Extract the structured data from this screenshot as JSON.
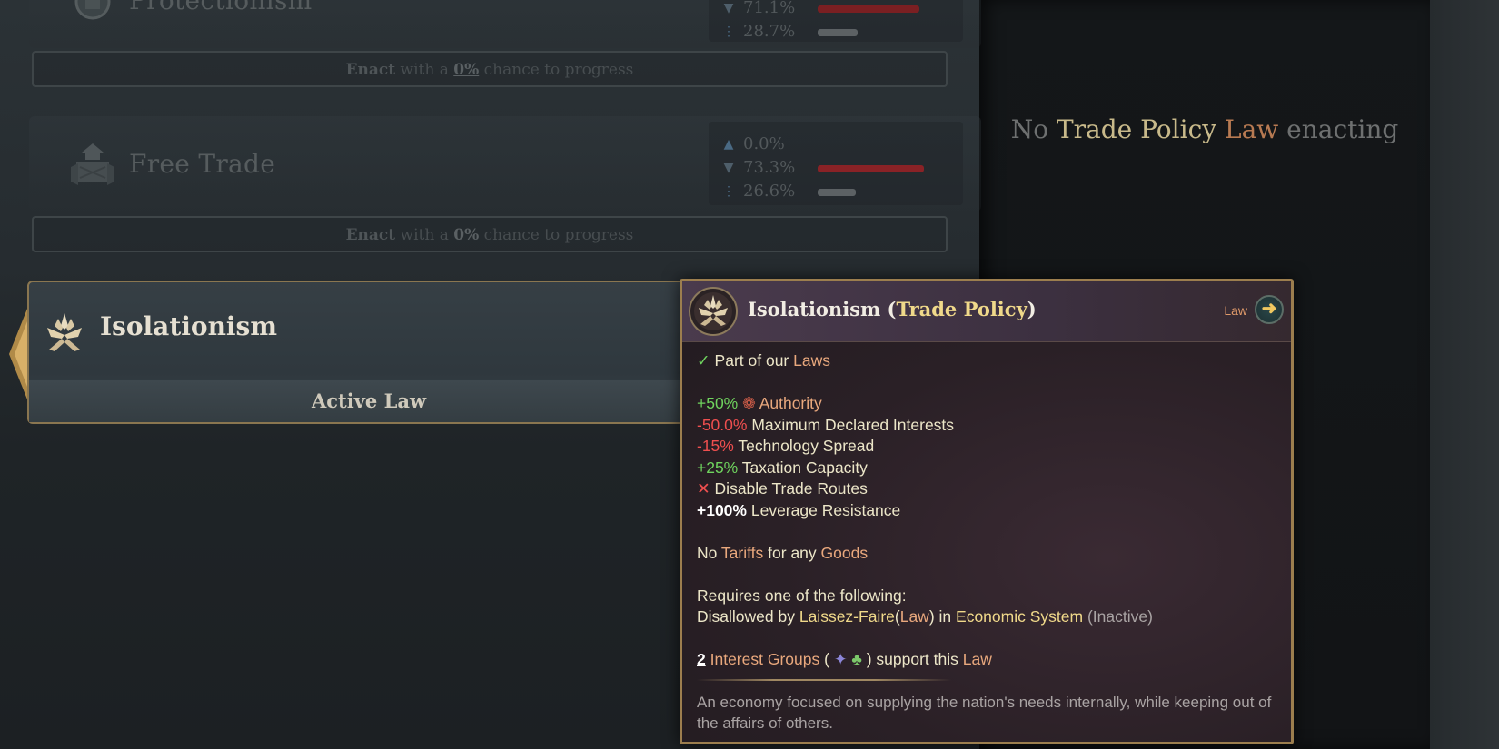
{
  "laws": [
    {
      "name": "Protectionism",
      "stats": {
        "oppose": "71.1%",
        "neutral": "28.7%"
      },
      "enact": {
        "prefix": "Enact",
        "middle": "with a",
        "chance": "0%",
        "suffix": "chance to progress"
      }
    },
    {
      "name": "Free Trade",
      "stats": {
        "support": "0.0%",
        "oppose": "73.3%",
        "neutral": "26.6%"
      },
      "enact": {
        "prefix": "Enact",
        "middle": "with a",
        "chance": "0%",
        "suffix": "chance to progress"
      }
    }
  ],
  "active_law": {
    "name": "Isolationism",
    "status": "Active Law"
  },
  "right_panel": {
    "no": "No",
    "category": "Trade Policy",
    "law": "Law",
    "suffix": "enacting"
  },
  "tooltip": {
    "title_name": "Isolationism",
    "title_category": "Trade Policy",
    "law_link": "Law",
    "part_of_prefix": "Part of our",
    "part_of_link": "Laws",
    "effects": [
      {
        "value": "+50%",
        "label": "Authority"
      },
      {
        "value": "-50.0%",
        "label": "Maximum Declared Interests"
      },
      {
        "value": "-15%",
        "label": "Technology Spread"
      },
      {
        "value": "+25%",
        "label": "Taxation Capacity"
      },
      {
        "value": "",
        "label": "Disable Trade Routes"
      },
      {
        "value": "+100%",
        "label": "Leverage Resistance"
      }
    ],
    "tariffs": {
      "no": "No",
      "tariffs": "Tariffs",
      "for_any": "for any",
      "goods": "Goods"
    },
    "requires": "Requires one of the following:",
    "disallowed": {
      "prefix": "Disallowed by",
      "law": "Laissez-Faire",
      "law_tag": "Law",
      "in": "in",
      "system": "Economic System",
      "state": "(Inactive)"
    },
    "support": {
      "count": "2",
      "groups": "Interest Groups",
      "suffix": "support this",
      "law": "Law"
    },
    "description": "An economy focused on supplying the nation's needs internally, while keeping out of the affairs of others."
  },
  "colors": {
    "positive": "#6fd35e",
    "negative": "#ef4f4f",
    "link": "#e9a87d",
    "highlight": "#f0d98a",
    "border_gold": "#9c7e4e"
  }
}
